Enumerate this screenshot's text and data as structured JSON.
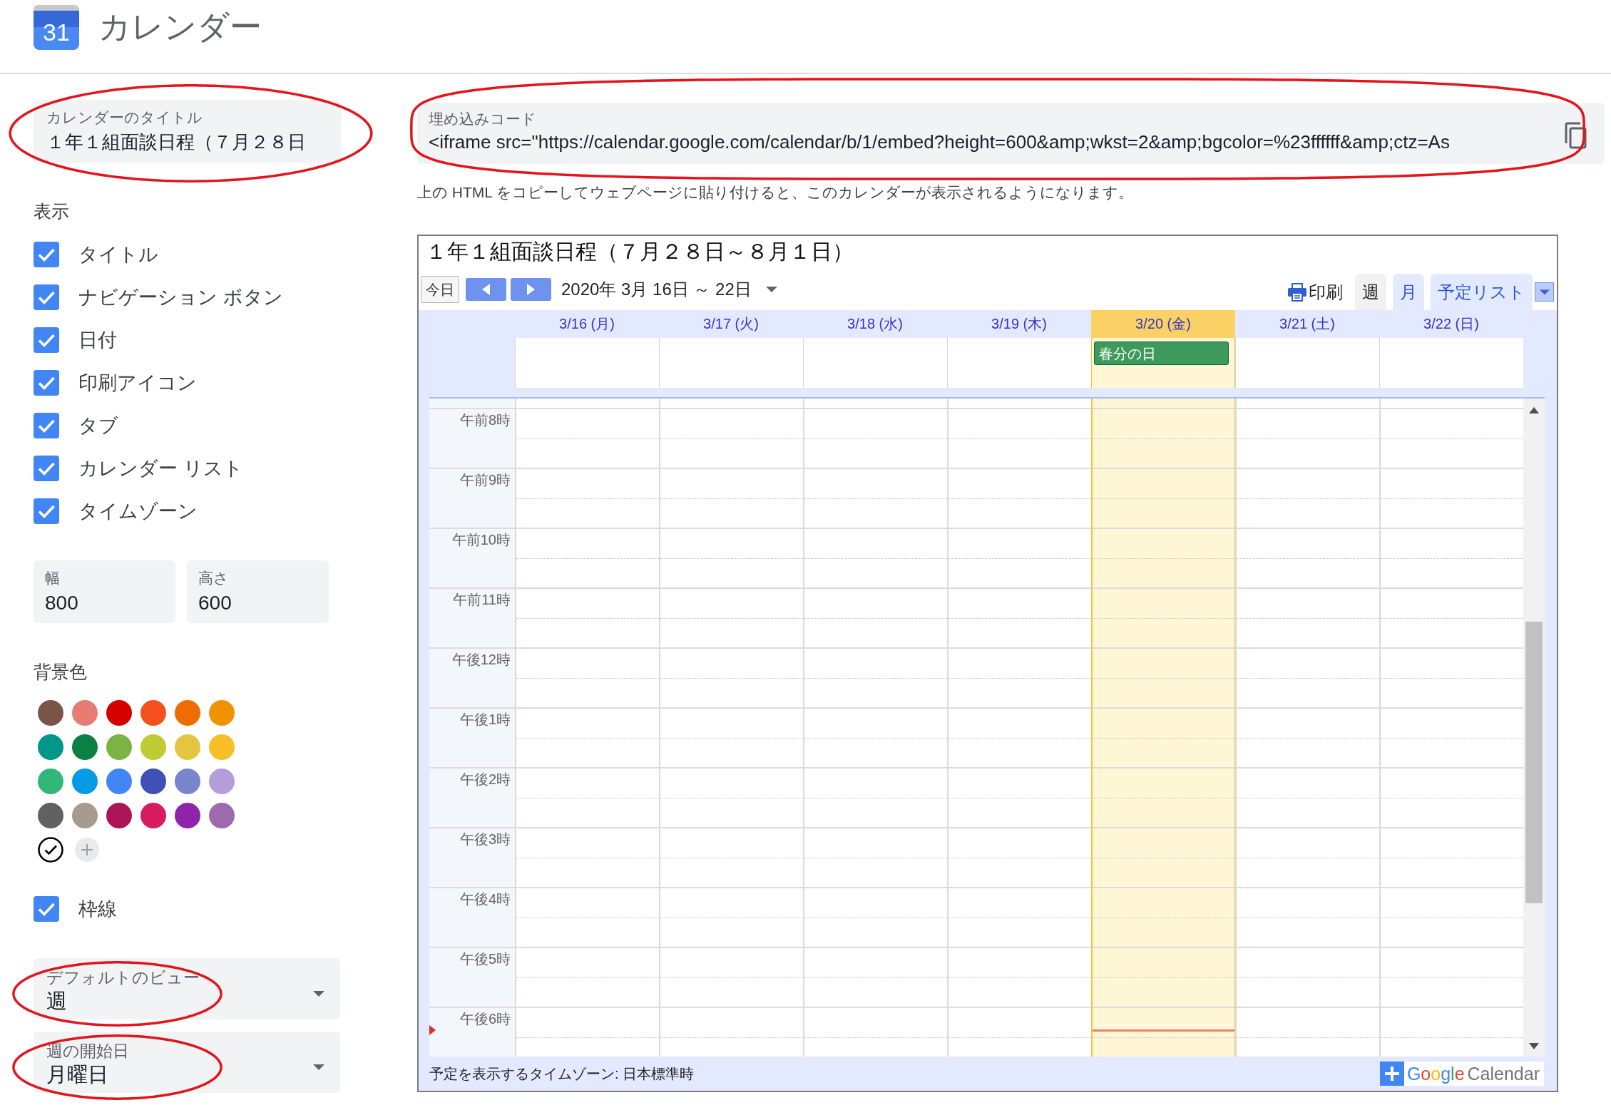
{
  "header": {
    "logo_day": "31",
    "app_title": "カレンダー"
  },
  "title_field": {
    "label": "カレンダーのタイトル",
    "value": "１年１組面談日程（７月２８日",
    "circled": true
  },
  "display": {
    "heading": "表示",
    "options": [
      {
        "label": "タイトル",
        "checked": true
      },
      {
        "label": "ナビゲーション ボタン",
        "checked": true
      },
      {
        "label": "日付",
        "checked": true
      },
      {
        "label": "印刷アイコン",
        "checked": true
      },
      {
        "label": "タブ",
        "checked": true
      },
      {
        "label": "カレンダー リスト",
        "checked": true
      },
      {
        "label": "タイムゾーン",
        "checked": true
      }
    ]
  },
  "size_fields": [
    {
      "label": "幅",
      "value": "800"
    },
    {
      "label": "高さ",
      "value": "600"
    }
  ],
  "background_color": {
    "heading": "背景色",
    "swatches": [
      {
        "color": "#795548",
        "selected": false
      },
      {
        "color": "#e67c73",
        "selected": false
      },
      {
        "color": "#d50000",
        "selected": false
      },
      {
        "color": "#f4511e",
        "selected": false
      },
      {
        "color": "#ef6c00",
        "selected": false
      },
      {
        "color": "#f09300",
        "selected": false
      },
      {
        "color": "#009688",
        "selected": false
      },
      {
        "color": "#0b8043",
        "selected": false
      },
      {
        "color": "#7cb342",
        "selected": false
      },
      {
        "color": "#c0ca33",
        "selected": false
      },
      {
        "color": "#e4c441",
        "selected": false
      },
      {
        "color": "#f6bf26",
        "selected": false
      },
      {
        "color": "#33b679",
        "selected": false
      },
      {
        "color": "#039be5",
        "selected": false
      },
      {
        "color": "#4285f4",
        "selected": false
      },
      {
        "color": "#3f51b5",
        "selected": false
      },
      {
        "color": "#7986cb",
        "selected": false
      },
      {
        "color": "#b39ddb",
        "selected": false
      },
      {
        "color": "#616161",
        "selected": false
      },
      {
        "color": "#a79b8e",
        "selected": false
      },
      {
        "color": "#ad1457",
        "selected": false
      },
      {
        "color": "#d81b60",
        "selected": false
      },
      {
        "color": "#8e24aa",
        "selected": false
      },
      {
        "color": "#9e69af",
        "selected": false
      },
      {
        "selected": true
      }
    ]
  },
  "border_option": {
    "label": "枠線",
    "checked": true
  },
  "dropdowns": [
    {
      "label": "デフォルトのビュー",
      "value": "週",
      "circled": true
    },
    {
      "label": "週の開始日",
      "value": "月曜日",
      "circled": true
    }
  ],
  "embed": {
    "label": "埋め込みコード",
    "value": "<iframe src=\"https://calendar.google.com/calendar/b/1/embed?height=600&amp;wkst=2&amp;bgcolor=%23ffffff&amp;ctz=As",
    "circled": true,
    "help_text": "上の HTML をコピーしてウェブページに貼り付けると、このカレンダーが表示されるようになります。"
  },
  "preview": {
    "title": "１年１組面談日程（７月２８日～８月１日）",
    "today_button": "今日",
    "date_range": "2020年 3月 16日 ～ 22日",
    "print_label": "印刷",
    "tabs": [
      {
        "label": "週",
        "selected": true
      },
      {
        "label": "月",
        "selected": false
      },
      {
        "label": "予定リスト",
        "selected": false
      }
    ],
    "days": [
      {
        "label": "3/16 (月)",
        "today": false
      },
      {
        "label": "3/17 (火)",
        "today": false
      },
      {
        "label": "3/18 (水)",
        "today": false
      },
      {
        "label": "3/19 (木)",
        "today": false
      },
      {
        "label": "3/20 (金)",
        "today": true,
        "events": [
          {
            "title": "春分の日"
          }
        ]
      },
      {
        "label": "3/21 (土)",
        "today": false
      },
      {
        "label": "3/22 (日)",
        "today": false
      }
    ],
    "hours": [
      {
        "label": "午前8時",
        "now": false
      },
      {
        "label": "午前9時",
        "now": false
      },
      {
        "label": "午前10時",
        "now": false
      },
      {
        "label": "午前11時",
        "now": false
      },
      {
        "label": "午後12時",
        "now": false
      },
      {
        "label": "午後1時",
        "now": false
      },
      {
        "label": "午後2時",
        "now": false
      },
      {
        "label": "午後3時",
        "now": false
      },
      {
        "label": "午後4時",
        "now": false
      },
      {
        "label": "午後5時",
        "now": false
      },
      {
        "label": "午後6時",
        "now": true
      }
    ],
    "timezone_note": "予定を表示するタイムゾーン: 日本標準時",
    "badge": {
      "brand": "Google",
      "product": "Calendar"
    }
  }
}
